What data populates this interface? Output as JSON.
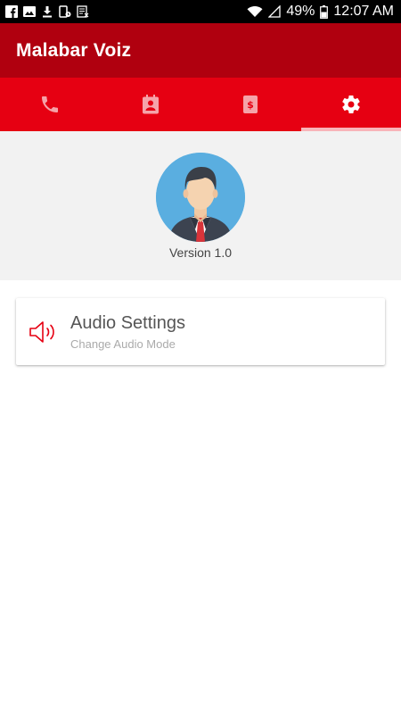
{
  "status_bar": {
    "battery": "49%",
    "time": "12:07 AM",
    "left_icons": [
      "facebook-icon",
      "image-icon",
      "download-icon",
      "phone-sim-icon",
      "document-icon"
    ],
    "right_icons": [
      "wifi-icon",
      "signal-icon",
      "battery-icon"
    ]
  },
  "app_bar": {
    "title": "Malabar Voiz"
  },
  "tabs": [
    {
      "icon": "phone-icon",
      "selected": false
    },
    {
      "icon": "contacts-icon",
      "selected": false
    },
    {
      "icon": "billing-book-icon",
      "selected": false
    },
    {
      "icon": "gear-icon",
      "selected": true
    }
  ],
  "profile": {
    "version": "Version 1.0"
  },
  "settings": [
    {
      "icon": "speaker-icon",
      "title": "Audio Settings",
      "subtitle": "Change Audio Mode"
    }
  ],
  "colors": {
    "app_bar": "#b0000f",
    "tab_bar": "#e60012",
    "tab_indicator": "#f8b4b9",
    "tab_icon_inactive": "#f5a3a9",
    "tab_icon_active": "#ffffff",
    "accent": "#e60012",
    "profile_background": "#f2f2f2"
  }
}
